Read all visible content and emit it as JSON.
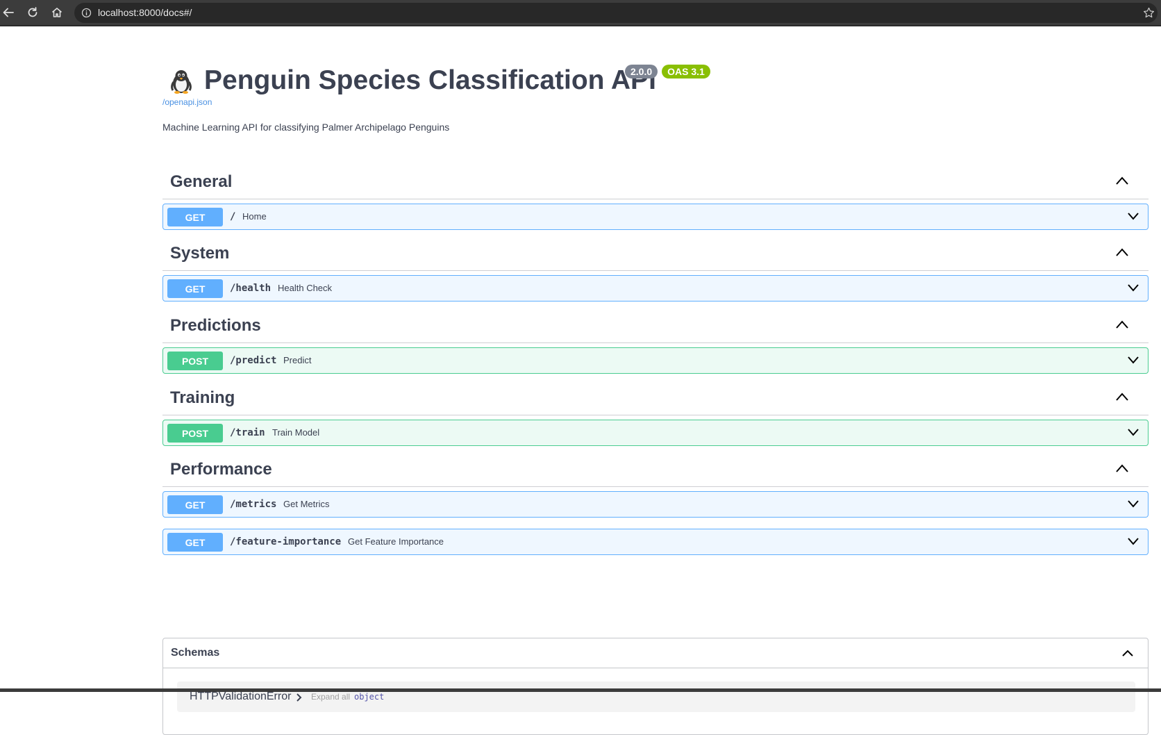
{
  "browser": {
    "url": "localhost:8000/docs#/"
  },
  "header": {
    "title": "Penguin Species Classification API",
    "version_badge": "2.0.0",
    "oas_badge": "OAS 3.1",
    "openapi_link": "/openapi.json",
    "description": "Machine Learning API for classifying Palmer Archipelago Penguins",
    "logo_icon": "penguin-emoji"
  },
  "sections": [
    {
      "title": "General",
      "operations": [
        {
          "method": "GET",
          "path": "/",
          "summary": "Home"
        }
      ]
    },
    {
      "title": "System",
      "operations": [
        {
          "method": "GET",
          "path": "/health",
          "summary": "Health Check"
        }
      ]
    },
    {
      "title": "Predictions",
      "operations": [
        {
          "method": "POST",
          "path": "/predict",
          "summary": "Predict"
        }
      ]
    },
    {
      "title": "Training",
      "operations": [
        {
          "method": "POST",
          "path": "/train",
          "summary": "Train Model"
        }
      ]
    },
    {
      "title": "Performance",
      "operations": [
        {
          "method": "GET",
          "path": "/metrics",
          "summary": "Get Metrics"
        },
        {
          "method": "GET",
          "path": "/feature-importance",
          "summary": "Get Feature Importance"
        }
      ]
    }
  ],
  "schemas": {
    "title": "Schemas",
    "models": [
      {
        "name": "HTTPValidationError",
        "expand_label": "Expand all",
        "type": "object"
      }
    ]
  },
  "colors": {
    "get": "#61affe",
    "post": "#49cc90",
    "version_badge": "#7d8492",
    "oas_badge": "#89bf04",
    "link": "#4990e2"
  }
}
